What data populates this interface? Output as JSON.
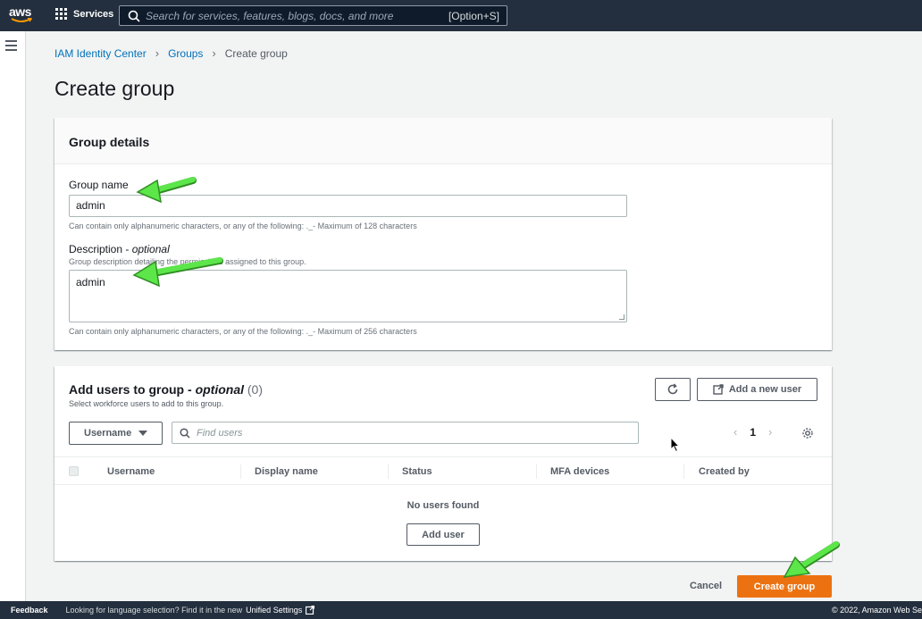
{
  "topnav": {
    "logo": "aws",
    "services_label": "Services",
    "search_placeholder": "Search for services, features, blogs, docs, and more",
    "search_shortcut": "[Option+S]"
  },
  "breadcrumb": [
    "IAM Identity Center",
    "Groups",
    "Create group"
  ],
  "page_title": "Create group",
  "group_details": {
    "header": "Group details",
    "name_label": "Group name",
    "name_value": "admin",
    "name_hint": "Can contain only alphanumeric characters, or any of the following: ._- Maximum of 128 characters",
    "desc_label": "Description",
    "desc_optional": "optional",
    "desc_sublabel": "Group description detailing the permissions assigned to this group.",
    "desc_value": "admin",
    "desc_hint": "Can contain only alphanumeric characters, or any of the following: ._- Maximum of 256 characters"
  },
  "add_users": {
    "title": "Add users to group -",
    "title_optional": "optional",
    "count": "(0)",
    "subtitle": "Select workforce users to add to this group.",
    "add_new_user_label": "Add a new user",
    "filter_select": "Username",
    "find_placeholder": "Find users",
    "page_number": "1",
    "columns": [
      "Username",
      "Display name",
      "Status",
      "MFA devices",
      "Created by"
    ],
    "empty_text": "No users found",
    "add_user_label": "Add user"
  },
  "actions": {
    "cancel": "Cancel",
    "create": "Create group"
  },
  "footer": {
    "feedback": "Feedback",
    "language_text": "Looking for language selection? Find it in the new",
    "unified_settings": "Unified Settings",
    "copyright": "© 2022, Amazon Web Se"
  },
  "colors": {
    "nav_bg": "#232f3e",
    "link": "#0073bb",
    "primary_button": "#ec7211",
    "annotation_arrow": "#5ce64a"
  },
  "icons": [
    "grid-icon",
    "search-icon",
    "hamburger-icon",
    "refresh-icon",
    "external-link-icon",
    "caret-down-icon",
    "chevron-left-icon",
    "chevron-right-icon",
    "gear-icon",
    "arrow-annotation-icon",
    "mouse-cursor-icon"
  ]
}
